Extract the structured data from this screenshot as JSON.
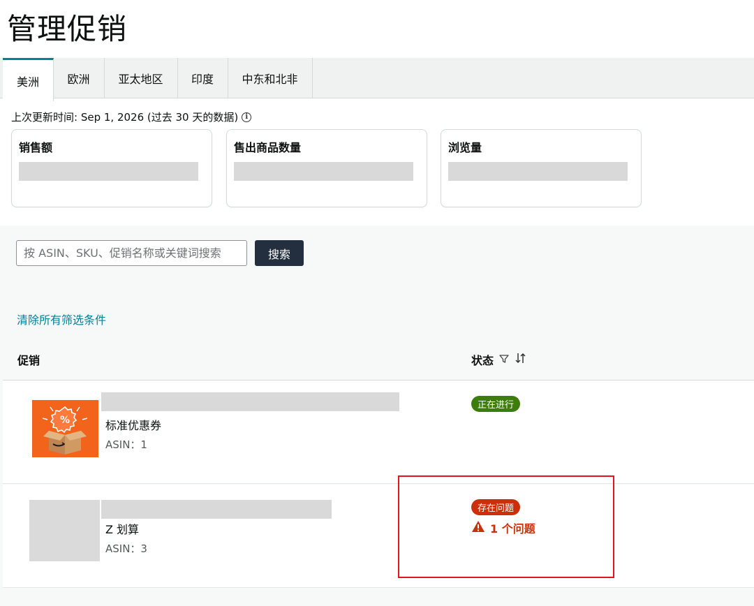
{
  "page": {
    "title": "管理促销"
  },
  "tabs": [
    {
      "label": "美洲",
      "active": true
    },
    {
      "label": "欧洲",
      "active": false
    },
    {
      "label": "亚太地区",
      "active": false
    },
    {
      "label": "印度",
      "active": false
    },
    {
      "label": "中东和北非",
      "active": false
    }
  ],
  "updated": {
    "text": "上次更新时间: Sep 1, 2026 (过去 30 天的数据)"
  },
  "metrics": [
    {
      "label": "销售额"
    },
    {
      "label": "售出商品数量"
    },
    {
      "label": "浏览量"
    }
  ],
  "search": {
    "placeholder": "按 ASIN、SKU、促销名称或关键词搜索",
    "button_label": "搜索"
  },
  "filters": {
    "clear_label": "清除所有筛选条件"
  },
  "table": {
    "col_promo": "促销",
    "col_status": "状态",
    "rows": [
      {
        "type": "标准优惠券",
        "asin": "ASIN：1",
        "status": "正在进行",
        "status_color": "#3c7d0b"
      },
      {
        "type": "Z 划算",
        "asin": "ASIN：3",
        "status": "存在问题",
        "status_color": "#cc2f0b",
        "issues": "1 个问题"
      }
    ]
  },
  "icons": {
    "info": "info-icon",
    "filter": "filter-icon",
    "sort": "sort-icon",
    "warning": "warning-icon"
  },
  "colors": {
    "accent": "#008296",
    "nav_dark": "#232f3e",
    "highlight": "#e5131b"
  }
}
